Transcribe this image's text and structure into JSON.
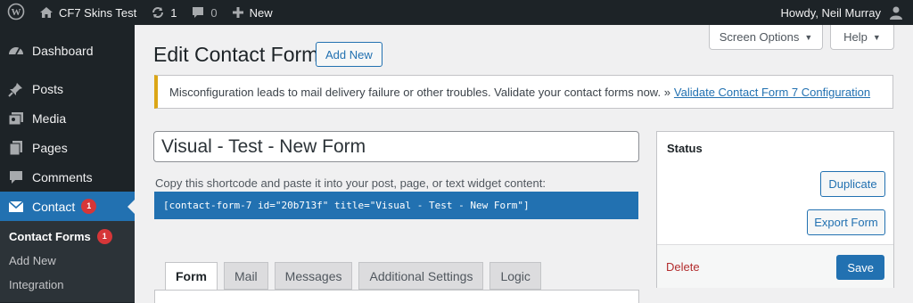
{
  "adminbar": {
    "site_name": "CF7 Skins Test",
    "updates_count": "1",
    "comments_count": "0",
    "new_label": "New",
    "howdy": "Howdy, Neil Murray"
  },
  "sidebar": {
    "items": [
      {
        "label": "Dashboard",
        "icon": "dashboard-icon"
      },
      {
        "label": "Posts",
        "icon": "pin-icon"
      },
      {
        "label": "Media",
        "icon": "media-icon"
      },
      {
        "label": "Pages",
        "icon": "pages-icon"
      },
      {
        "label": "Comments",
        "icon": "comment-icon"
      },
      {
        "label": "Contact",
        "icon": "mail-icon",
        "badge": "1"
      }
    ],
    "submenu": [
      {
        "label": "Contact Forms",
        "badge": "1"
      },
      {
        "label": "Add New"
      },
      {
        "label": "Integration"
      }
    ]
  },
  "header": {
    "screen_options": "Screen Options",
    "help": "Help",
    "title": "Edit Contact Form",
    "add_new": "Add New"
  },
  "notice": {
    "text": "Misconfiguration leads to mail delivery failure or other troubles. Validate your contact forms now. »",
    "link": "Validate Contact Form 7 Configuration"
  },
  "form": {
    "title_value": "Visual - Test - New Form",
    "shortcode_label": "Copy this shortcode and paste it into your post, page, or text widget content:",
    "shortcode": "[contact-form-7 id=\"20b713f\" title=\"Visual - Test - New Form\"]",
    "tabs": [
      "Form",
      "Mail",
      "Messages",
      "Additional Settings",
      "Logic"
    ]
  },
  "status": {
    "title": "Status",
    "duplicate": "Duplicate",
    "export": "Export Form",
    "delete": "Delete",
    "save": "Save"
  },
  "colors": {
    "admin_bar": "#1d2327",
    "accent": "#2271b1",
    "badge": "#d63638",
    "notice_border": "#dba617"
  }
}
